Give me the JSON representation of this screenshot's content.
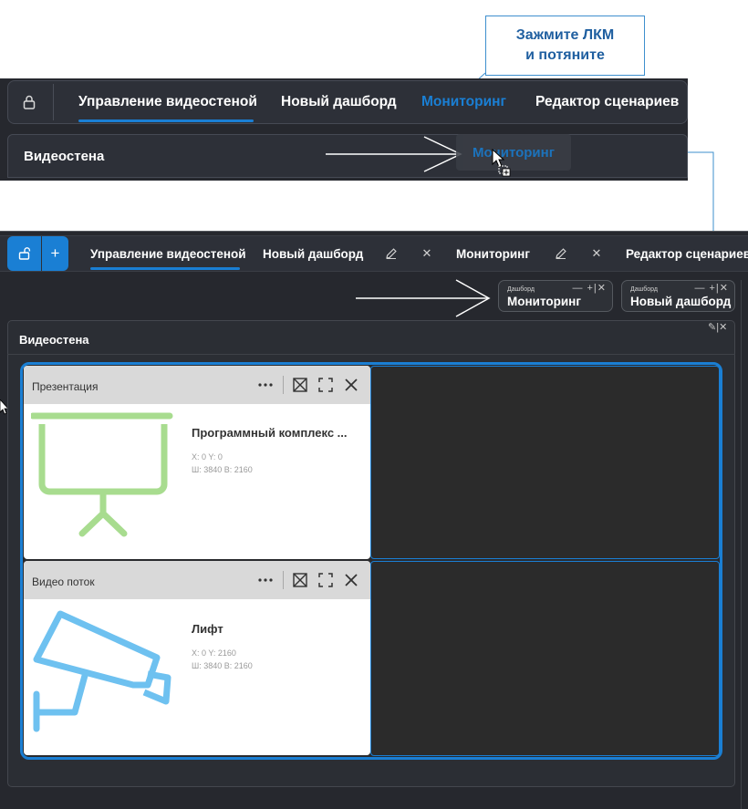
{
  "callout": {
    "line1": "Зажмите ЛКМ",
    "line2": "и потяните",
    "color": "#1f5fa0"
  },
  "top_strip": {
    "tabs": [
      {
        "label": "Управление видеостеной",
        "active": true
      },
      {
        "label": "Новый дашборд"
      },
      {
        "label": "Мониторинг",
        "dragging": true
      },
      {
        "label": "Редактор сценариев"
      }
    ],
    "panel_title": "Видеостена",
    "ghost_label": "Мониторинг",
    "lock_icon": "lock-icon"
  },
  "tabbar": {
    "unlock_icon": "unlock-icon",
    "add_icon": "plus-icon",
    "add_label": "+",
    "tabs": [
      {
        "label": "Управление видеостеной",
        "active": true
      },
      {
        "label": "Новый дашборд",
        "edit_icon": "pencil-icon",
        "close_label": "✕"
      },
      {
        "label": "Мониторинг",
        "edit_icon": "pencil-icon",
        "close_label": "✕"
      },
      {
        "label": "Редактор сценариев"
      }
    ]
  },
  "chips": [
    {
      "small": "Дашборд",
      "big": "Мониторинг",
      "ctrls": "— +|✕"
    },
    {
      "small": "Дашборд",
      "big": "Новый дашборд",
      "ctrls": "— +|✕"
    }
  ],
  "panel": {
    "title": "Видеостена",
    "ctrls": "✎|✕"
  },
  "cards": [
    {
      "header": "Презентация",
      "name": "Программный комплекс ...",
      "pos": "X: 0 Y: 0",
      "size": "Ш: 3840 В: 2160",
      "icon": "presentation-board-icon",
      "icon_color": "#a8dc8f"
    },
    {
      "header": "Видео поток",
      "name": "Лифт",
      "pos": "X: 0 Y: 2160",
      "size": "Ш: 3840 В: 2160",
      "icon": "security-camera-icon",
      "icon_color": "#6ec1f0"
    }
  ],
  "colors": {
    "accent": "#1a7fd4",
    "bg": "#26282e",
    "panel": "#2d3038"
  }
}
